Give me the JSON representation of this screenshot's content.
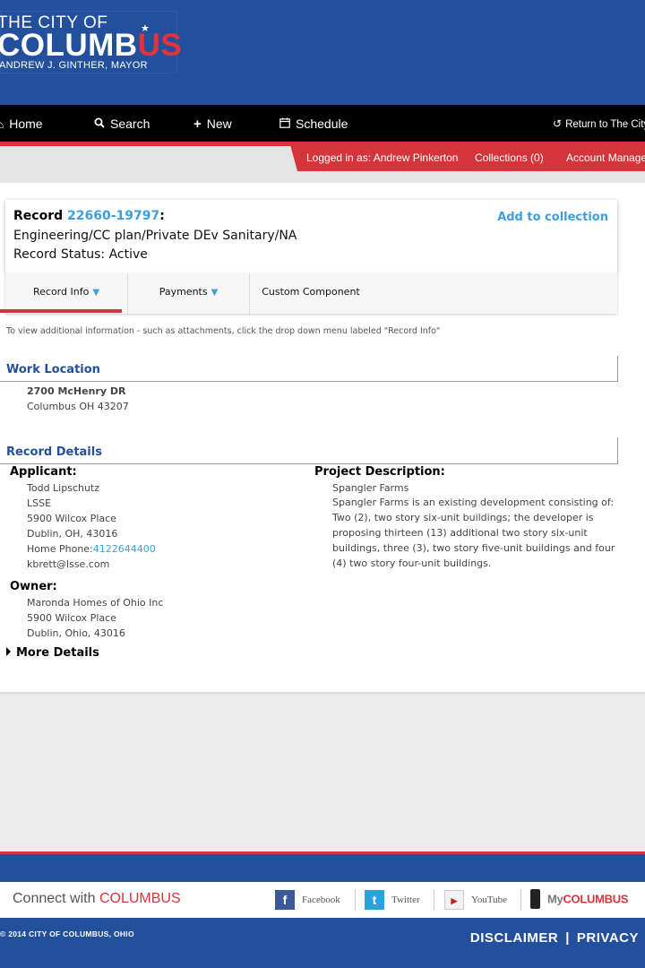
{
  "header": {
    "logo_line1": "THE CITY OF",
    "logo_line2_main": "COLUMB",
    "logo_line2_accent": "US",
    "logo_line3": "ANDREW J. GINTHER, MAYOR"
  },
  "nav": {
    "items": [
      {
        "label": "Home",
        "icon": "home-icon"
      },
      {
        "label": "Search",
        "icon": "search-icon"
      },
      {
        "label": "New",
        "icon": "plus-icon"
      },
      {
        "label": "Schedule",
        "icon": "calendar-icon"
      }
    ],
    "return_label": "Return to The City"
  },
  "userbar": {
    "logged_in": "Logged in as: Andrew Pinkerton",
    "collections": "Collections (0)",
    "account": "Account Management"
  },
  "record": {
    "label": "Record",
    "number": "22660-19797",
    "suffix": ":",
    "type": "Engineering/CC plan/Private DEv Sanitary/NA",
    "status": "Record Status: Active",
    "add_to_collection": "Add to collection"
  },
  "tabs": [
    {
      "label": "Record Info",
      "has_caret": true
    },
    {
      "label": "Payments",
      "has_caret": true
    },
    {
      "label": "Custom Component",
      "has_caret": false
    }
  ],
  "helper_text": "To view additional information - such as attachments, click the drop down menu labeled \"Record Info\"",
  "work_location": {
    "title": "Work Location",
    "street": "2700 McHenry DR",
    "city_line": "Columbus OH 43207"
  },
  "record_details": {
    "title": "Record Details",
    "applicant": {
      "label": "Applicant:",
      "name": "Todd Lipschutz",
      "company": "LSSE",
      "address1": "5900 Wilcox Place",
      "address2": "Dublin, OH, 43016",
      "phone_label": "Home Phone:",
      "phone": "4122644400",
      "email": "kbrett@lsse.com"
    },
    "owner": {
      "label": "Owner:",
      "name": "Maronda Homes of Ohio Inc",
      "address1": "5900 Wilcox Place",
      "address2": "Dublin, Ohio, 43016"
    },
    "project": {
      "label": "Project Description:",
      "name": "Spangler Farms",
      "description": "Spangler Farms is an existing development consisting of: Two (2), two story six-unit buildings; the developer is proposing thirteen (13) additional two story six-unit buildings, three (3), two story five-unit buildings and four (4) two story four-unit buildings."
    },
    "more_details": "More Details"
  },
  "footer": {
    "connect_prefix": "Connect with",
    "connect_accent": "COLUMBUS",
    "social": [
      {
        "label": "Facebook",
        "icon": "facebook-icon",
        "color": "#3b5998"
      },
      {
        "label": "Twitter",
        "icon": "twitter-icon",
        "color": "#2aa3dd"
      },
      {
        "label": "YouTube",
        "icon": "youtube-icon",
        "color": "#cc2020"
      }
    ],
    "mycolumbus_prefix": "My",
    "mycolumbus_accent": "COLUMBUS",
    "copyright": "© 2014 CITY OF COLUMBUS, OHIO",
    "disclaimer": "DISCLAIMER",
    "privacy": "PRIVACY"
  },
  "colors": {
    "brand_blue": "#22509c",
    "brand_red": "#d4353b",
    "link_blue": "#3d9fdc"
  }
}
